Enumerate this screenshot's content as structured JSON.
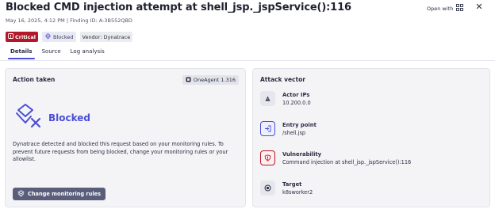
{
  "header": {
    "title": "Blocked CMD injection attempt at shell_jsp._jspService():116",
    "subtitle": "May 16, 2025, 4:12 PM | Finding ID: A-3B552QBD",
    "open_with_label": "Open with",
    "close_glyph": "✕"
  },
  "badges": {
    "critical": "Critical",
    "blocked": "Blocked",
    "vendor": "Vendor: Dynatrace"
  },
  "tabs": [
    {
      "label": "Details",
      "active": true
    },
    {
      "label": "Source",
      "active": false
    },
    {
      "label": "Log analysis",
      "active": false
    }
  ],
  "action_taken": {
    "title": "Action taken",
    "agent_label": "OneAgent 1.316",
    "status_label": "Blocked",
    "description": "Dynatrace detected and blocked this request based on your monitoring rules. To prevent future requests from being blocked, change your monitoring rules or your allowlist.",
    "button_label": "Change monitoring rules"
  },
  "attack_vector": {
    "title": "Attack vector",
    "items": [
      {
        "label": "Actor IPs",
        "value": "10.200.0.0",
        "icon": "actor-icon"
      },
      {
        "label": "Entry point",
        "value": "/shell.jsp",
        "icon": "entry-point-icon"
      },
      {
        "label": "Vulnerability",
        "value": "Command injection at shell_jsp._jspService():116",
        "icon": "vulnerability-icon"
      },
      {
        "label": "Target",
        "value": "k8sworker2",
        "icon": "target-icon"
      }
    ]
  },
  "colors": {
    "accent": "#4a4fd6",
    "critical": "#b2182b",
    "button": "#5a5e7a"
  }
}
